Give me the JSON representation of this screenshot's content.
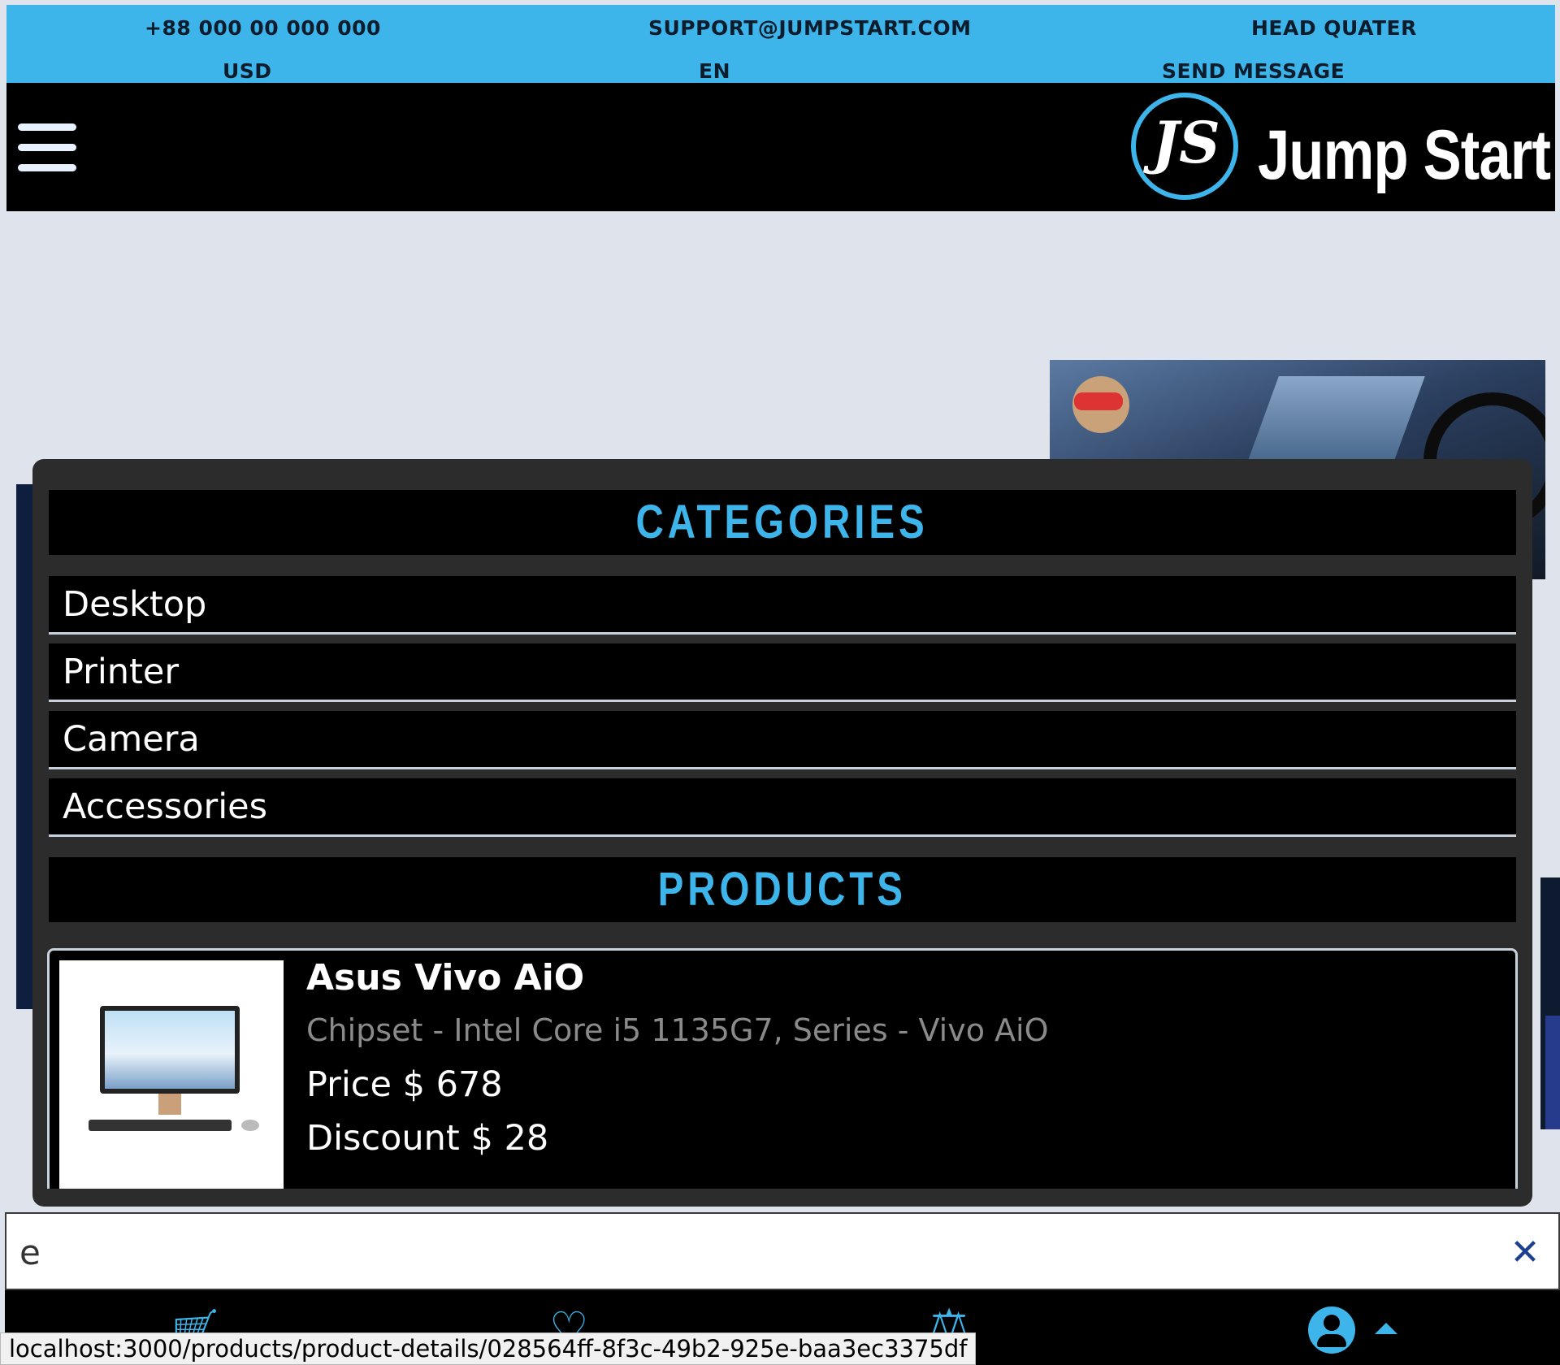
{
  "topbar": {
    "phone": "+88 000 00 000 000",
    "email": "SUPPORT@JUMPSTART.COM",
    "head_quarter": "HEAD QUATER",
    "currency": "USD",
    "language": "EN",
    "send_message": "SEND MESSAGE"
  },
  "header": {
    "brand": "Jump Start",
    "logo_monogram": "JS"
  },
  "search_results": {
    "categories_title": "CATEGORIES",
    "categories": [
      {
        "label": "Desktop"
      },
      {
        "label": "Printer"
      },
      {
        "label": "Camera"
      },
      {
        "label": "Accessories"
      }
    ],
    "products_title": "PRODUCTS",
    "products": [
      {
        "name": "Asus Vivo AiO",
        "spec": "Chipset - Intel Core i5 1135G7, Series - Vivo AiO",
        "price": "Price $ 678",
        "discount": "Discount $ 28"
      }
    ]
  },
  "search": {
    "value": "e",
    "clear_icon": "close-icon"
  },
  "bottom_nav": {
    "icons": [
      "cart-icon",
      "heart-icon",
      "compare-scale-icon",
      "user-account-icon",
      "caret-up-icon"
    ]
  },
  "status_bar": {
    "url": "localhost:3000/products/product-details/028564ff-8f3c-49b2-925e-baa3ec3375df"
  },
  "colors": {
    "accent": "#3db5ea",
    "header_bg": "#000000",
    "panel_bg": "#2c2c2c",
    "page_bg": "#dfe4ec",
    "clear_icon": "#1c3f8f"
  }
}
